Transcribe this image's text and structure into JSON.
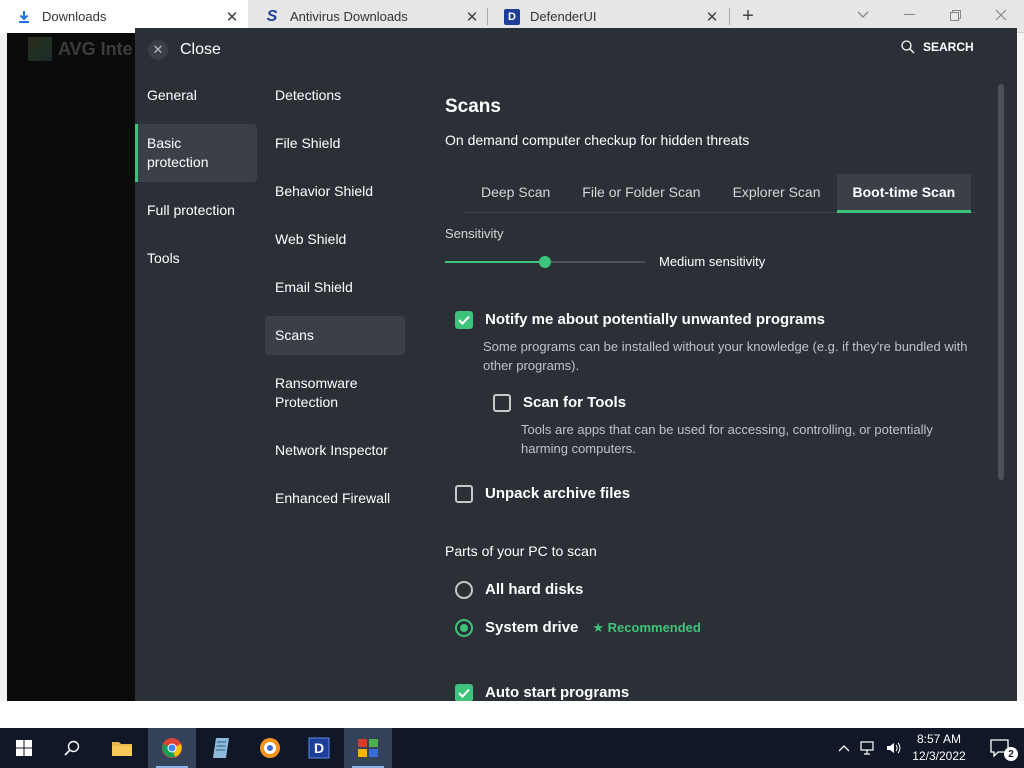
{
  "browser": {
    "tabs": [
      {
        "label": "Downloads",
        "icon": "download-icon"
      },
      {
        "label": "Antivirus Downloads",
        "icon": "s-logo-icon"
      },
      {
        "label": "DefenderUI",
        "icon": "d-logo-icon"
      }
    ]
  },
  "background": {
    "logo_text": "AVG Inte"
  },
  "panel": {
    "close_label": "Close",
    "search_label": "SEARCH",
    "nav_primary": [
      {
        "label": "General"
      },
      {
        "label": "Basic protection"
      },
      {
        "label": "Full protection"
      },
      {
        "label": "Tools"
      }
    ],
    "nav_secondary": [
      {
        "label": "Detections"
      },
      {
        "label": "File Shield"
      },
      {
        "label": "Behavior Shield"
      },
      {
        "label": "Web Shield"
      },
      {
        "label": "Email Shield"
      },
      {
        "label": "Scans"
      },
      {
        "label": "Ransomware Protection"
      },
      {
        "label": "Network Inspector"
      },
      {
        "label": "Enhanced Firewall"
      }
    ],
    "content": {
      "title": "Scans",
      "subtitle": "On demand computer checkup for hidden threats",
      "tabs": [
        {
          "label": "Deep Scan"
        },
        {
          "label": "File or Folder Scan"
        },
        {
          "label": "Explorer Scan"
        },
        {
          "label": "Boot-time Scan"
        }
      ],
      "active_tab": "Boot-time Scan",
      "sensitivity": {
        "label": "Sensitivity",
        "value_text": "Medium sensitivity",
        "level": 0.5
      },
      "options": {
        "pup": {
          "label": "Notify me about potentially unwanted programs",
          "checked": true,
          "desc": "Some programs can be installed without your knowledge (e.g. if they're bundled with other programs)."
        },
        "tools": {
          "label": "Scan for Tools",
          "checked": false,
          "desc": "Tools are apps that can be used for accessing, controlling, or potentially harming computers."
        },
        "unpack": {
          "label": "Unpack archive files",
          "checked": false
        }
      },
      "parts_title": "Parts of your PC to scan",
      "parts": {
        "all_disks": {
          "label": "All hard disks",
          "selected": false
        },
        "system_drive": {
          "label": "System drive",
          "selected": true,
          "badge": "★ Recommended"
        }
      },
      "auto_start": {
        "label": "Auto start programs",
        "checked": true
      }
    }
  },
  "taskbar": {
    "time": "8:57 AM",
    "date": "12/3/2022",
    "notifications": "2"
  },
  "colors": {
    "accent": "#3ec47a",
    "panel_bg": "#2b2f36",
    "item_active_bg": "#3b4048",
    "taskbar_bg": "#101827"
  }
}
